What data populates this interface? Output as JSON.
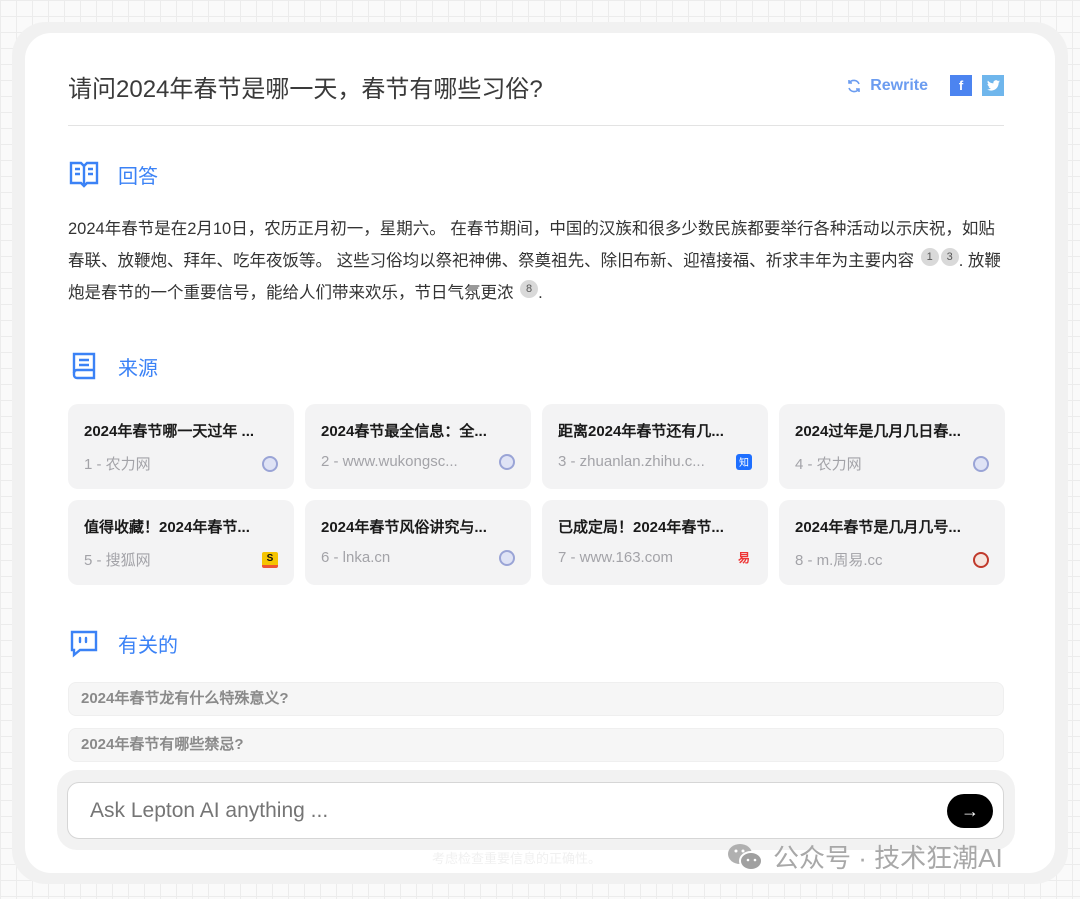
{
  "question": "请问2024年春节是哪一天，春节有哪些习俗?",
  "actions": {
    "rewrite": "Rewrite",
    "facebook": "f",
    "twitter": "t"
  },
  "answer_section": {
    "heading": "回答",
    "text1": "2024年春节是在2月10日，农历正月初一，星期六。 在春节期间，中国的汉族和很多少数民族都要举行各种活动以示庆祝，如贴春联、放鞭炮、拜年、吃年夜饭等。 这些习俗均以祭祀神佛、祭奠祖先、除旧布新、迎禧接福、祈求丰年为主要内容",
    "cite1": "1",
    "cite2": "3",
    "text2": ". 放鞭炮是春节的一个重要信号，能给人们带来欢乐，节日气氛更浓",
    "cite3": "8",
    "text3": "."
  },
  "sources_section": {
    "heading": "来源",
    "items": [
      {
        "title": "2024年春节哪一天过年 ...",
        "meta": "1 - 农力网",
        "icon": "globe"
      },
      {
        "title": "2024春节最全信息：全...",
        "meta": "2 - www.wukongsc...",
        "icon": "globe"
      },
      {
        "title": "距离2024年春节还有几...",
        "meta": "3 - zhuanlan.zhihu.c...",
        "icon": "zhihu",
        "icon_text": "知"
      },
      {
        "title": "2024过年是几月几日春...",
        "meta": "4 - 农力网",
        "icon": "globe"
      },
      {
        "title": "值得收藏！2024年春节...",
        "meta": "5 - 搜狐网",
        "icon": "sohu",
        "icon_text": "S"
      },
      {
        "title": "2024年春节风俗讲究与...",
        "meta": "6 - lnka.cn",
        "icon": "globe"
      },
      {
        "title": "已成定局！2024年春节...",
        "meta": "7 - www.163.com",
        "icon": "netease",
        "icon_text": "易"
      },
      {
        "title": "2024年春节是几月几号...",
        "meta": "8 - m.周易.cc",
        "icon": "zhouyi"
      }
    ]
  },
  "related_section": {
    "heading": "有关的",
    "items": [
      "2024年春节龙有什么特殊意义?",
      "2024年春节有哪些禁忌?"
    ]
  },
  "input": {
    "placeholder": "Ask Lepton AI anything ..."
  },
  "footnote": "考虑检查重要信息的正确性。",
  "watermark": "公众号 · 技术狂潮AI"
}
